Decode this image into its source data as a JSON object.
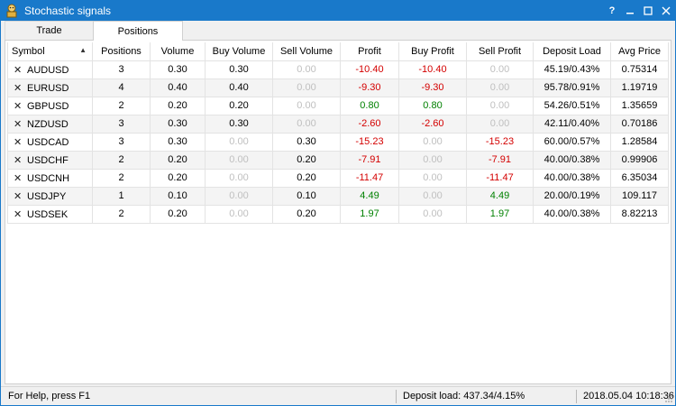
{
  "window": {
    "title": "Stochastic signals",
    "buttons": {
      "help": "?",
      "minimize": "—",
      "maximize": "□",
      "close": "✕"
    }
  },
  "tabs": [
    {
      "label": "Trade",
      "active": false
    },
    {
      "label": "Positions",
      "active": true
    }
  ],
  "table": {
    "columns": [
      "Symbol",
      "Positions",
      "Volume",
      "Buy Volume",
      "Sell Volume",
      "Profit",
      "Buy Profit",
      "Sell Profit",
      "Deposit Load",
      "Avg Price"
    ],
    "rows": [
      [
        "AUDUSD",
        "3",
        "0.30",
        "0.30",
        "0.00",
        "-10.40",
        "-10.40",
        "0.00",
        "45.19/0.43%",
        "0.75314"
      ],
      [
        "EURUSD",
        "4",
        "0.40",
        "0.40",
        "0.00",
        "-9.30",
        "-9.30",
        "0.00",
        "95.78/0.91%",
        "1.19719"
      ],
      [
        "GBPUSD",
        "2",
        "0.20",
        "0.20",
        "0.00",
        "0.80",
        "0.80",
        "0.00",
        "54.26/0.51%",
        "1.35659"
      ],
      [
        "NZDUSD",
        "3",
        "0.30",
        "0.30",
        "0.00",
        "-2.60",
        "-2.60",
        "0.00",
        "42.11/0.40%",
        "0.70186"
      ],
      [
        "USDCAD",
        "3",
        "0.30",
        "0.00",
        "0.30",
        "-15.23",
        "0.00",
        "-15.23",
        "60.00/0.57%",
        "1.28584"
      ],
      [
        "USDCHF",
        "2",
        "0.20",
        "0.00",
        "0.20",
        "-7.91",
        "0.00",
        "-7.91",
        "40.00/0.38%",
        "0.99906"
      ],
      [
        "USDCNH",
        "2",
        "0.20",
        "0.00",
        "0.20",
        "-11.47",
        "0.00",
        "-11.47",
        "40.00/0.38%",
        "6.35034"
      ],
      [
        "USDJPY",
        "1",
        "0.10",
        "0.00",
        "0.10",
        "4.49",
        "0.00",
        "4.49",
        "20.00/0.19%",
        "109.117"
      ],
      [
        "USDSEK",
        "2",
        "0.20",
        "0.00",
        "0.20",
        "1.97",
        "0.00",
        "1.97",
        "40.00/0.38%",
        "8.82213"
      ]
    ]
  },
  "statusbar": {
    "help": "For Help, press F1",
    "deposit_load": "Deposit load: 437.34/4.15%",
    "datetime": "2018.05.04 10:18:36"
  },
  "colors": {
    "titlebar": "#1979ca",
    "negative": "#d40000",
    "positive": "#008000",
    "zero": "#bfbfbf"
  }
}
